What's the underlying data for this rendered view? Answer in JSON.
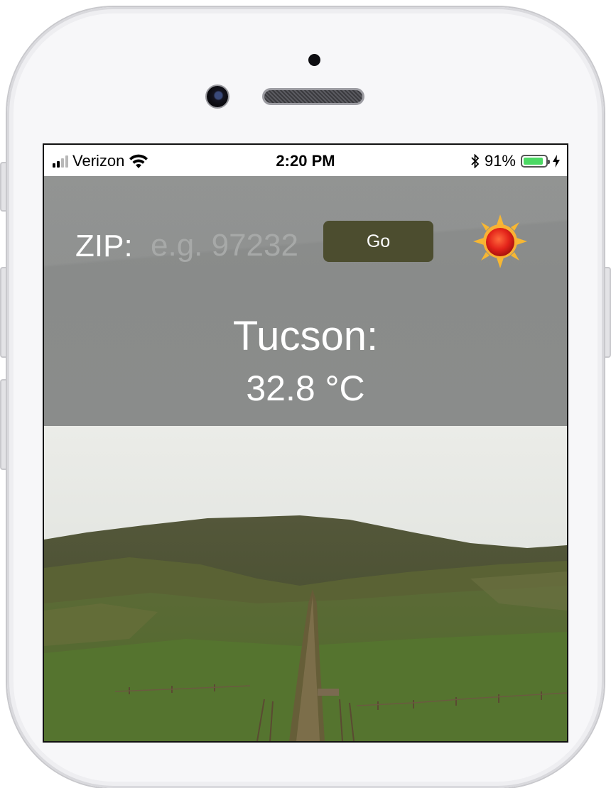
{
  "status_bar": {
    "carrier": "Verizon",
    "time": "2:20 PM",
    "battery_percent": "91%",
    "battery_level": 0.91,
    "bluetooth_icon": "bluetooth-icon",
    "wifi_icon": "wifi-icon",
    "charging_icon": "bolt-icon"
  },
  "form": {
    "zip_label": "ZIP:",
    "zip_placeholder": "e.g. 97232",
    "zip_value": "",
    "go_label": "Go"
  },
  "weather": {
    "city": "Tucson:",
    "temperature": "32.8 °C",
    "icon": "sun-icon"
  },
  "colors": {
    "go_button": "#4c4d2f",
    "overlay": "#8a8c8b",
    "battery": "#4cd964"
  }
}
